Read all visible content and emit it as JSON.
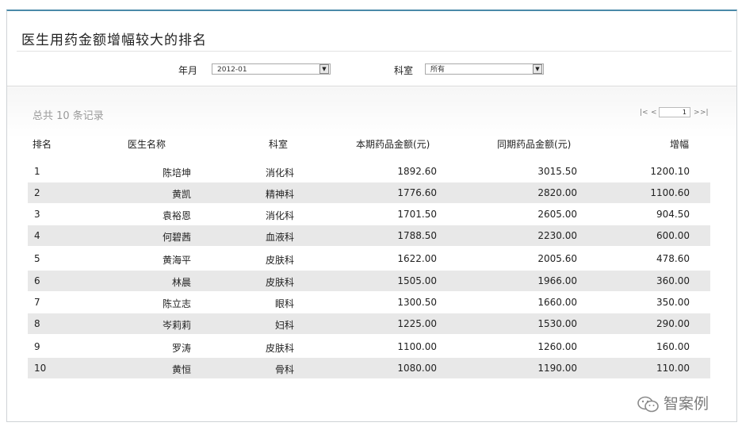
{
  "title": "医生用药金额增幅较大的排名",
  "filters": {
    "month_label": "年月",
    "month_value": "2012-01",
    "dept_label": "科室",
    "dept_value": "所有"
  },
  "summary": {
    "total_text": "总共 10 条记录"
  },
  "pager": {
    "first": "|<",
    "prev": "<",
    "page": "1",
    "next": ">",
    "last": ">|"
  },
  "table": {
    "columns": [
      "排名",
      "医生名称",
      "科室",
      "本期药品金额(元)",
      "同期药品金额(元)",
      "增幅"
    ],
    "rows": [
      [
        "1",
        "陈培坤",
        "消化科",
        "1892.60",
        "3015.50",
        "1200.10"
      ],
      [
        "2",
        "黄凯",
        "精神科",
        "1776.60",
        "2820.00",
        "1100.60"
      ],
      [
        "3",
        "袁裕恩",
        "消化科",
        "1701.50",
        "2605.00",
        "904.50"
      ],
      [
        "4",
        "何碧茜",
        "血液科",
        "1788.50",
        "2230.00",
        "600.00"
      ],
      [
        "5",
        "黄海平",
        "皮肤科",
        "1622.00",
        "2005.60",
        "478.60"
      ],
      [
        "6",
        "林晨",
        "皮肤科",
        "1505.00",
        "1966.00",
        "360.00"
      ],
      [
        "7",
        "陈立志",
        "眼科",
        "1300.50",
        "1660.00",
        "350.00"
      ],
      [
        "8",
        "岑莉莉",
        "妇科",
        "1225.00",
        "1530.00",
        "290.00"
      ],
      [
        "9",
        "罗涛",
        "皮肤科",
        "1100.00",
        "1260.00",
        "160.00"
      ],
      [
        "10",
        "黄恒",
        "骨科",
        "1080.00",
        "1190.00",
        "110.00"
      ]
    ]
  },
  "watermark": "智案例",
  "colors": {
    "accent_border": "#4a8aa8",
    "row_alt": "#e8e8e8"
  }
}
